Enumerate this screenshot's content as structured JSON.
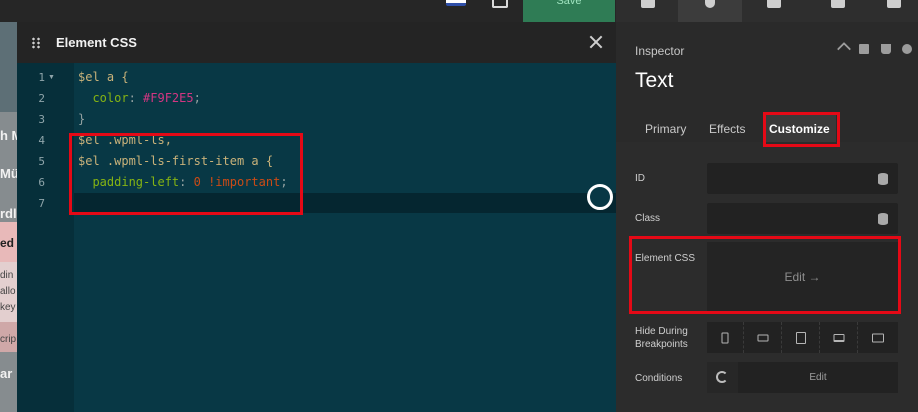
{
  "topbar": {
    "save_label": "Save"
  },
  "background_page": {
    "fragments": [
      "h M",
      "Mü",
      "rdl",
      "ed",
      "din",
      "allo",
      "key",
      "crip",
      "ar"
    ]
  },
  "modal": {
    "title": "Element CSS",
    "line_numbers": [
      "1",
      "2",
      "3",
      "4",
      "5",
      "6",
      "7"
    ],
    "code": {
      "l1_sel": "$el a {",
      "l2_prop": "color",
      "l2_val": "#F9F2E5",
      "l3": "}",
      "l4_sel": "$el .wpml-ls,",
      "l5_sel": "$el .wpml-ls-first-item a {",
      "l6_prop": "padding-left",
      "l6_num": "0",
      "l6_imp": "!important"
    }
  },
  "inspector": {
    "label": "Inspector",
    "element_title": "Text",
    "tabs": [
      "Primary",
      "Effects",
      "Customize"
    ],
    "active_tab": "Customize",
    "fields": {
      "id_label": "ID",
      "class_label": "Class",
      "element_css_label": "Element CSS",
      "element_css_action": "Edit →",
      "hide_breakpoints_label": "Hide During Breakpoints",
      "conditions_label": "Conditions",
      "conditions_action": "Edit"
    }
  },
  "colors": {
    "editor_bg": "#083845",
    "annotation": "#e50916",
    "save_bg": "#2f7c55"
  }
}
